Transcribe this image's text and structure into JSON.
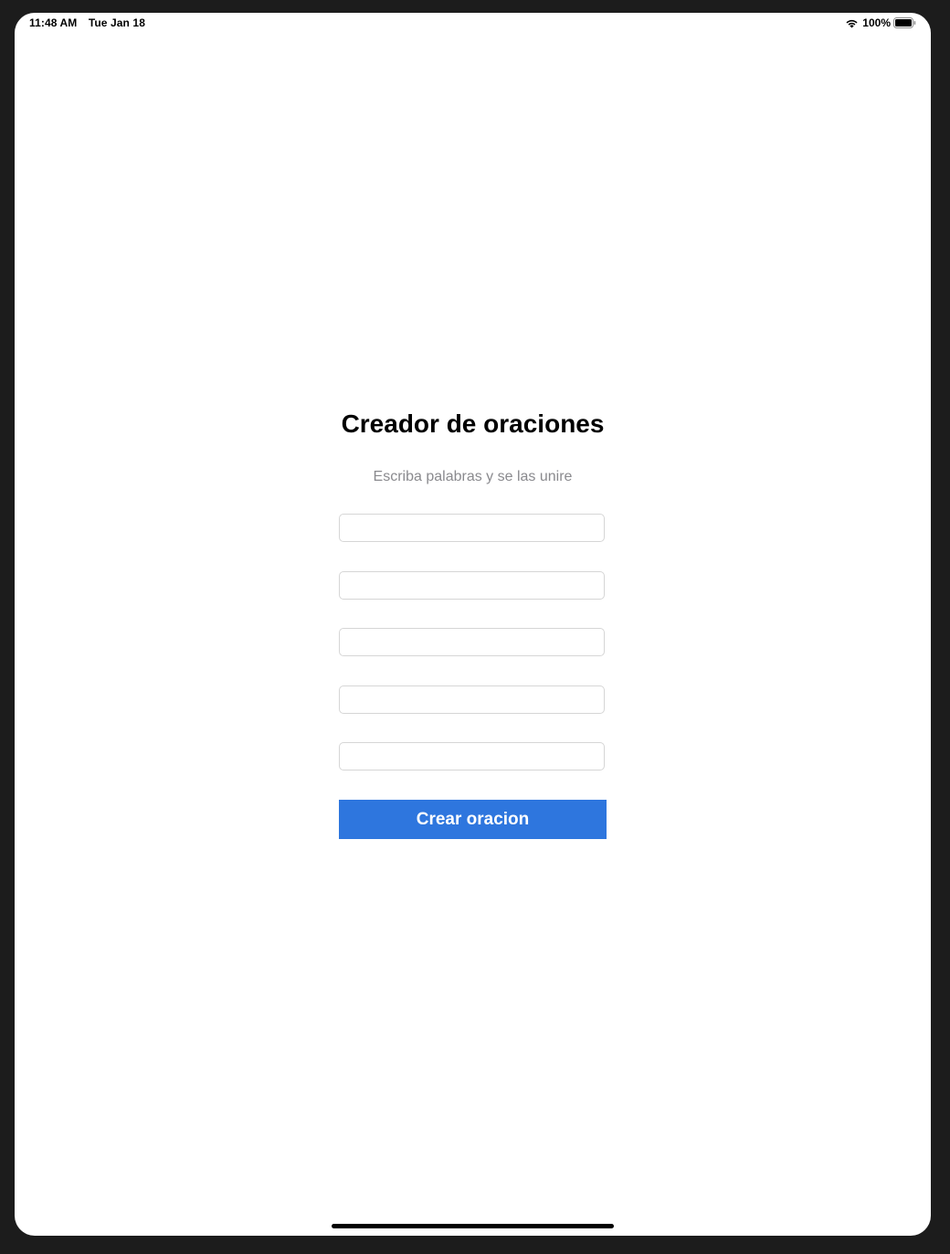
{
  "status_bar": {
    "time": "11:48 AM",
    "date": "Tue Jan 18",
    "battery_percent": "100%",
    "battery_level": 1.0,
    "icons": [
      "wifi-icon",
      "battery-icon"
    ]
  },
  "form": {
    "title": "Creador de oraciones",
    "subtitle": "Escriba palabras y se las unire",
    "inputs": [
      {
        "value": ""
      },
      {
        "value": ""
      },
      {
        "value": ""
      },
      {
        "value": ""
      },
      {
        "value": ""
      }
    ],
    "button_label": "Crear oracion"
  },
  "colors": {
    "accent": "#2e76de",
    "subtitle": "#8a8a8e",
    "background": "#ffffff"
  }
}
